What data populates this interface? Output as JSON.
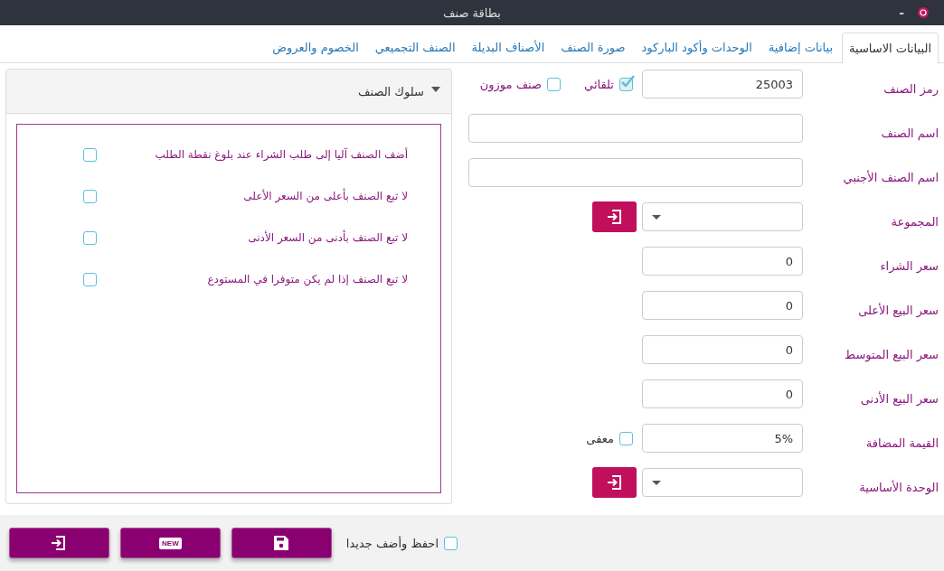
{
  "window": {
    "title": "بطاقة صنف",
    "minimize": "-"
  },
  "tabs": [
    {
      "label": "البيانات الاساسية",
      "selected": true
    },
    {
      "label": "بيانات إضافية",
      "selected": false
    },
    {
      "label": "الوحدات وأكود الباركود",
      "selected": false
    },
    {
      "label": "صورة الصنف",
      "selected": false
    },
    {
      "label": "الأصناف البديلة",
      "selected": false
    },
    {
      "label": "الصنف التجميعي",
      "selected": false
    },
    {
      "label": "الخصوم والعروض",
      "selected": false
    }
  ],
  "form": [
    {
      "kind": "text",
      "label": "رمز الصنف",
      "value": "25003",
      "checks": [
        {
          "label": "تلقائي",
          "checked": true
        },
        {
          "label": "صنف موزون",
          "checked": false
        }
      ]
    },
    {
      "kind": "wide",
      "label": "اسم الصنف"
    },
    {
      "kind": "wide",
      "label": "اسم الصنف الأجنبي"
    },
    {
      "kind": "select",
      "label": "المجموعة"
    },
    {
      "kind": "text",
      "label": "سعر الشراء",
      "value": "0"
    },
    {
      "kind": "text",
      "label": "سعر البيع الأعلى",
      "value": "0"
    },
    {
      "kind": "text",
      "label": "سعر البيع المتوسط",
      "value": "0"
    },
    {
      "kind": "text",
      "label": "سعر البيع الأدنى",
      "value": "0"
    },
    {
      "kind": "text",
      "label": "القيمة المضافة",
      "value": "5%",
      "checks": [
        {
          "label": "معفى",
          "checked": false
        }
      ]
    },
    {
      "kind": "select",
      "label": "الوحدة الأساسية"
    }
  ],
  "panel": {
    "title": "سلوك الصنف",
    "expanded": true,
    "options": [
      {
        "label": "أضف الصنف آليا إلى طلب الشراء عند بلوغ نقطة الطلب",
        "checked": false
      },
      {
        "label": "لا تبع الصنف بأعلى من السعر الأعلى",
        "checked": false
      },
      {
        "label": "لا تبع الصنف بأدنى  من السعر الأدنى",
        "checked": false
      },
      {
        "label": "لا تبع الصنف إذا لم يكن متوفرا في المستودع",
        "checked": false
      }
    ]
  },
  "footer": {
    "save_and_new": {
      "label": "احفظ وأضف جديدا",
      "checked": false
    },
    "buttons": [
      {
        "kind": "save"
      },
      {
        "kind": "new",
        "text": "NEW"
      },
      {
        "kind": "exit"
      }
    ]
  }
}
